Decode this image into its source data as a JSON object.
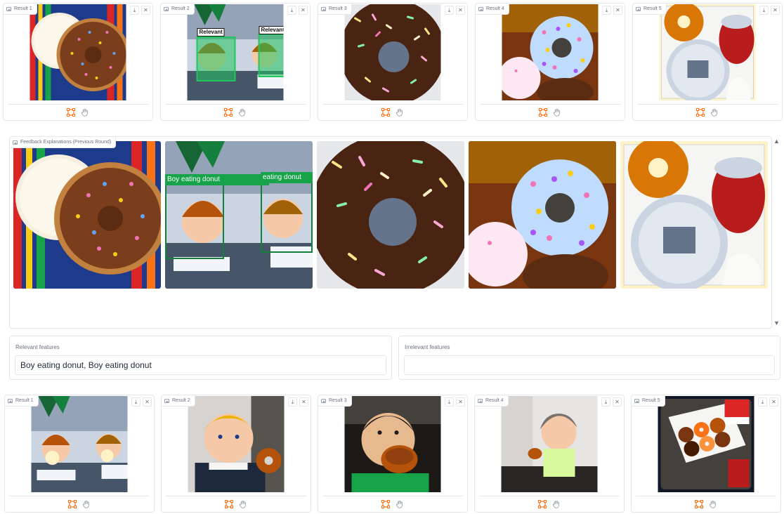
{
  "top_results": [
    {
      "label": "Result 1",
      "image": "glazed-and-sprinkle-donuts",
      "has_relevant_boxes": false
    },
    {
      "label": "Result 2",
      "image": "boys-eating-donuts",
      "has_relevant_boxes": true,
      "box_labels": [
        "Relevant",
        "Relevant"
      ]
    },
    {
      "label": "Result 3",
      "image": "chocolate-sprinkle-donut",
      "has_relevant_boxes": false
    },
    {
      "label": "Result 4",
      "image": "donuts-with-heart-sprinkles",
      "has_relevant_boxes": false
    },
    {
      "label": "Result 5",
      "image": "coffee-cups-and-donut",
      "has_relevant_boxes": false
    }
  ],
  "feedback_gallery": {
    "label": "Feedback Explanations (Previous Round)",
    "images": [
      {
        "image": "glazed-and-sprinkle-donuts"
      },
      {
        "image": "boys-eating-donuts",
        "explanations": [
          "Boy eating donut",
          "eating donut"
        ]
      },
      {
        "image": "chocolate-sprinkle-donut"
      },
      {
        "image": "donuts-with-heart-sprinkles"
      },
      {
        "image": "coffee-cups-and-donut"
      }
    ]
  },
  "relevant_features": {
    "label": "Relevant features",
    "value": "Boy eating donut, Boy eating donut"
  },
  "irrelevant_features": {
    "label": "Irrelevant features",
    "value": ""
  },
  "bottom_results": [
    {
      "label": "Result 1",
      "image": "boys-eating-donuts"
    },
    {
      "label": "Result 2",
      "image": "boy-holding-donut"
    },
    {
      "label": "Result 3",
      "image": "child-biting-donut"
    },
    {
      "label": "Result 4",
      "image": "boy-eating-at-table"
    },
    {
      "label": "Result 5",
      "image": "box-of-donuts"
    }
  ],
  "icons": {
    "download": "download-icon",
    "close": "close-icon",
    "select": "box-select-icon",
    "hand": "hand-icon"
  },
  "colors": {
    "accent": "#f97316",
    "relevant_box": "#22c55e",
    "explanation_box": "#16a34a"
  }
}
